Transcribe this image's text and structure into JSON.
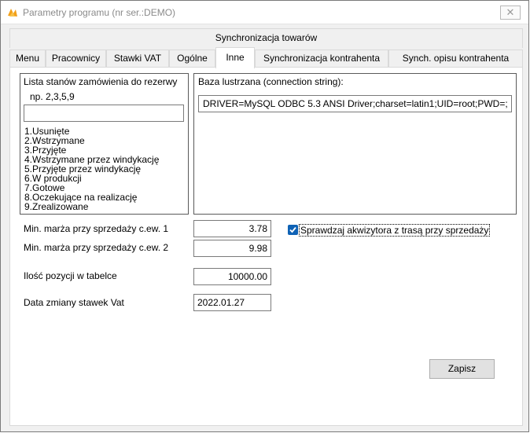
{
  "window": {
    "title": "Parametry programu (nr ser.:DEMO)",
    "close_glyph": "✕"
  },
  "header": {
    "sync_title": "Synchronizacja towarów"
  },
  "tabs": [
    {
      "label": "Menu"
    },
    {
      "label": "Pracownicy"
    },
    {
      "label": "Stawki VAT"
    },
    {
      "label": "Ogólne"
    },
    {
      "label": "Inne",
      "active": true
    },
    {
      "label": "Synchronizacja kontrahenta"
    },
    {
      "label": "Synch. opisu kontrahenta"
    }
  ],
  "order_states": {
    "title": "Lista stanów zamówienia do rezerwy",
    "example": "np. 2,3,5,9",
    "input_value": "",
    "items": [
      "1.Usunięte",
      "2.Wstrzymane",
      "3.Przyjęte",
      "4.Wstrzymane przez windykację",
      "5.Przyjęte przez windykację",
      "6.W produkcji",
      "7.Gotowe",
      "8.Oczekujące na realizację",
      "9.Zrealizowane"
    ]
  },
  "mirror_db": {
    "title": "Baza lustrzana (connection string):",
    "value": "DRIVER=MySQL ODBC 5.3 ANSI Driver;charset=latin1;UID=root;PWD=;"
  },
  "fields": {
    "margin1_label": "Min. marża przy sprzedaży c.ew. 1",
    "margin1_value": "3.78",
    "margin2_label": "Min. marża przy sprzedaży c.ew. 2",
    "margin2_value": "9.98",
    "rows_label": "Ilość pozycji w tabelce",
    "rows_value": "10000.00",
    "vat_date_label": "Data zmiany stawek Vat",
    "vat_date_value": "2022.01.27"
  },
  "checkbox": {
    "label": "Sprawdzaj akwizytora z trasą  przy sprzedaży",
    "checked": true
  },
  "buttons": {
    "save_label": "Zapisz"
  },
  "colors": {
    "checkbox_accent": "#0f62b5",
    "app_icon": "#f2a01a"
  }
}
